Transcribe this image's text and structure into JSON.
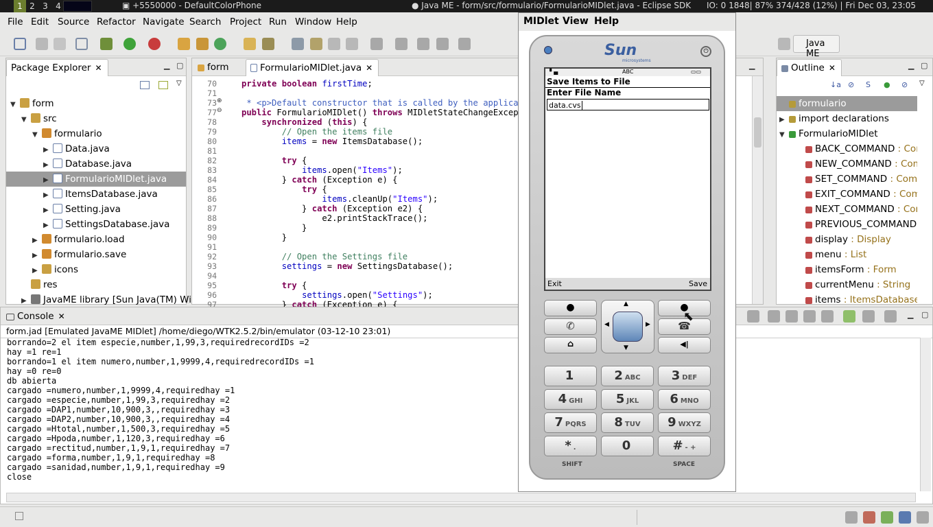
{
  "taskbar": {
    "workspaces": [
      "1",
      "2",
      "3",
      "4"
    ],
    "app1": "+5550000 - DefaultColorPhone",
    "app2": "Java ME - form/src/formulario/FormularioMIDlet.java - Eclipse SDK",
    "stats": "IO:     0  1848| 87% 374/428 (12%) | Fri Dec 03, 23:05"
  },
  "menu": [
    "File",
    "Edit",
    "Source",
    "Refactor",
    "Navigate",
    "Search",
    "Project",
    "Run",
    "Window",
    "Help"
  ],
  "perspective": "Java ME",
  "package_explorer": {
    "title": "Package Explorer",
    "tree": [
      {
        "label": "form",
        "depth": 0,
        "arrow": "▼",
        "kind": "project"
      },
      {
        "label": "src",
        "depth": 1,
        "arrow": "▼",
        "kind": "folder"
      },
      {
        "label": "formulario",
        "depth": 2,
        "arrow": "▼",
        "kind": "package"
      },
      {
        "label": "Data.java",
        "depth": 3,
        "arrow": "▶",
        "kind": "java"
      },
      {
        "label": "Database.java",
        "depth": 3,
        "arrow": "▶",
        "kind": "java"
      },
      {
        "label": "FormularioMIDlet.java",
        "depth": 3,
        "arrow": "▶",
        "kind": "java",
        "selected": true
      },
      {
        "label": "ItemsDatabase.java",
        "depth": 3,
        "arrow": "▶",
        "kind": "java"
      },
      {
        "label": "Setting.java",
        "depth": 3,
        "arrow": "▶",
        "kind": "java"
      },
      {
        "label": "SettingsDatabase.java",
        "depth": 3,
        "arrow": "▶",
        "kind": "java"
      },
      {
        "label": "formulario.load",
        "depth": 2,
        "arrow": "▶",
        "kind": "package"
      },
      {
        "label": "formulario.save",
        "depth": 2,
        "arrow": "▶",
        "kind": "package"
      },
      {
        "label": "icons",
        "depth": 2,
        "arrow": "▶",
        "kind": "folder"
      },
      {
        "label": "res",
        "depth": 1,
        "arrow": "",
        "kind": "folder"
      },
      {
        "label": "JavaME library [Sun Java(TM) Wirel",
        "depth": 1,
        "arrow": "▶",
        "kind": "lib"
      }
    ]
  },
  "editor": {
    "tabs": [
      "form",
      "FormularioMIDlet.java"
    ],
    "lines": [
      {
        "n": "70",
        "t": "private boolean firstTime;"
      },
      {
        "n": "71",
        "t": ""
      },
      {
        "n": "73",
        "t": " * <p>Default constructor that is called by the applicatio"
      },
      {
        "n": "77",
        "t": "public FormularioMIDlet() throws MIDletStateChangeException"
      },
      {
        "n": "78",
        "t": "    synchronized (this) {"
      },
      {
        "n": "79",
        "t": "        // Open the items file"
      },
      {
        "n": "80",
        "t": "        items = new ItemsDatabase();"
      },
      {
        "n": "81",
        "t": ""
      },
      {
        "n": "82",
        "t": "        try {"
      },
      {
        "n": "83",
        "t": "            items.open(\"Items\");"
      },
      {
        "n": "84",
        "t": "        } catch (Exception e) {"
      },
      {
        "n": "85",
        "t": "            try {"
      },
      {
        "n": "86",
        "t": "                items.cleanUp(\"Items\");"
      },
      {
        "n": "87",
        "t": "            } catch (Exception e2) {"
      },
      {
        "n": "88",
        "t": "                e2.printStackTrace();"
      },
      {
        "n": "89",
        "t": "            }"
      },
      {
        "n": "90",
        "t": "        }"
      },
      {
        "n": "91",
        "t": ""
      },
      {
        "n": "92",
        "t": "        // Open the Settings file"
      },
      {
        "n": "93",
        "t": "        settings = new SettingsDatabase();"
      },
      {
        "n": "94",
        "t": ""
      },
      {
        "n": "95",
        "t": "        try {"
      },
      {
        "n": "96",
        "t": "            settings.open(\"Settings\");"
      },
      {
        "n": "97",
        "t": "        } catch (Exception e) {"
      }
    ]
  },
  "outline": {
    "title": "Outline",
    "items": [
      {
        "label": "formulario",
        "type": "",
        "sel": true,
        "ind": 0,
        "arrow": ""
      },
      {
        "label": "import declarations",
        "type": "",
        "ind": 0,
        "arrow": "▶"
      },
      {
        "label": "FormularioMIDlet",
        "type": "",
        "ind": 0,
        "arrow": "▼"
      },
      {
        "label": "BACK_COMMAND",
        "type": " : Comm",
        "ind": 1,
        "arrow": ""
      },
      {
        "label": "NEW_COMMAND",
        "type": " : Comm",
        "ind": 1,
        "arrow": ""
      },
      {
        "label": "SET_COMMAND",
        "type": " : Comm",
        "ind": 1,
        "arrow": ""
      },
      {
        "label": "EXIT_COMMAND",
        "type": " : Comm",
        "ind": 1,
        "arrow": ""
      },
      {
        "label": "NEXT_COMMAND",
        "type": " : Comr",
        "ind": 1,
        "arrow": ""
      },
      {
        "label": "PREVIOUS_COMMAND",
        "type": " :",
        "ind": 1,
        "arrow": ""
      },
      {
        "label": "display",
        "type": " : Display",
        "ind": 1,
        "arrow": ""
      },
      {
        "label": "menu",
        "type": " : List",
        "ind": 1,
        "arrow": ""
      },
      {
        "label": "itemsForm",
        "type": " : Form",
        "ind": 1,
        "arrow": ""
      },
      {
        "label": "currentMenu",
        "type": " : String",
        "ind": 1,
        "arrow": ""
      },
      {
        "label": "items",
        "type": " : ItemsDatabase",
        "ind": 1,
        "arrow": ""
      }
    ]
  },
  "console": {
    "title": "Console",
    "header": "form.jad [Emulated JavaME MIDlet] /home/diego/WTK2.5.2/bin/emulator (03-12-10 23:01)",
    "lines": [
      "borrando=2 el item especie,number,1,99,3,requiredrecordIDs =2",
      "hay =1 re=1",
      "borrando=1 el item numero,number,1,9999,4,requiredrecordIDs =1",
      "hay =0 re=0",
      "db abierta",
      "cargado =numero,number,1,9999,4,requiredhay =1",
      "cargado =especie,number,1,99,3,requiredhay =2",
      "cargado =DAP1,number,10,900,3,,requiredhay =3",
      "cargado =DAP2,number,10,900,3,,requiredhay =4",
      "cargado =Htotal,number,1,500,3,requiredhay =5",
      "cargado =Hpoda,number,1,120,3,requiredhay =6",
      "cargado =rectitud,number,1,9,1,requiredhay =7",
      "cargado =forma,number,1,9,1,requiredhay =8",
      "cargado =sanidad,number,1,9,1,requiredhay =9",
      "close"
    ]
  },
  "emulator": {
    "menu": [
      "MIDlet",
      "View",
      "Help"
    ],
    "brand": "Sun",
    "brand_sub": "microsystems",
    "status_mode": "ABC",
    "screen_title": "Save Items to File",
    "field_label": "Enter File Name",
    "field_value": "data.cvs",
    "soft_left": "Exit",
    "soft_right": "Save",
    "keys": [
      {
        "n": "1",
        "l": ""
      },
      {
        "n": "2",
        "l": "ABC"
      },
      {
        "n": "3",
        "l": "DEF"
      },
      {
        "n": "4",
        "l": "GHI"
      },
      {
        "n": "5",
        "l": "JKL"
      },
      {
        "n": "6",
        "l": "MNO"
      },
      {
        "n": "7",
        "l": "PQRS"
      },
      {
        "n": "8",
        "l": "TUV"
      },
      {
        "n": "9",
        "l": "WXYZ"
      },
      {
        "n": "*",
        "l": "."
      },
      {
        "n": "0",
        "l": ""
      },
      {
        "n": "#",
        "l": "- +"
      }
    ],
    "shift": "SHIFT",
    "space": "SPACE"
  },
  "colors": {
    "accent": "#6b7d2e",
    "selection": "#9b9b9b",
    "keyword": "#7f0055",
    "comment": "#3f7f5f",
    "string": "#2a00ff"
  }
}
